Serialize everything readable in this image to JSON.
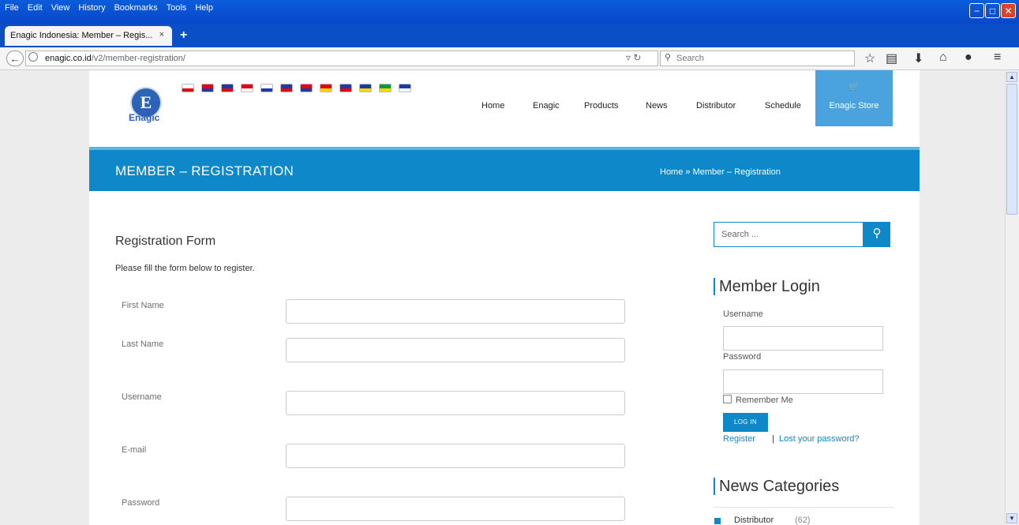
{
  "window": {
    "menu": [
      "File",
      "Edit",
      "View",
      "History",
      "Bookmarks",
      "Tools",
      "Help"
    ],
    "controls": {
      "minimize": "−",
      "restore": "□",
      "close": "✕"
    }
  },
  "browser": {
    "tab_title": "Enagic Indonesia: Member – Regis...",
    "tab_close": "×",
    "new_tab": "+",
    "url_domain": "enagic.co.id",
    "url_path": "/v2/member-registration/",
    "search_placeholder": "Search",
    "icons": [
      "back-icon",
      "globe-icon",
      "reload-icon",
      "search-icon",
      "star-icon",
      "reading-list-icon",
      "download-icon",
      "home-icon",
      "chat-icon",
      "menu-icon"
    ]
  },
  "site": {
    "logo_letter": "E",
    "logo_text": "Enagic",
    "flags": [
      {
        "name": "japan",
        "color": "#ffffff",
        "accent": "#e60012"
      },
      {
        "name": "taiwan",
        "color": "#e60012",
        "accent": "#1a3ca5"
      },
      {
        "name": "philippines",
        "color": "#1a3ca5",
        "accent": "#e60012"
      },
      {
        "name": "singapore",
        "color": "#e60012",
        "accent": "#ffffff"
      },
      {
        "name": "korea",
        "color": "#ffffff",
        "accent": "#1a3ca5"
      },
      {
        "name": "thailand",
        "color": "#1a3ca5",
        "accent": "#e60012"
      },
      {
        "name": "malaysia",
        "color": "#e60012",
        "accent": "#1a3ca5"
      },
      {
        "name": "vietnam",
        "color": "#e60012",
        "accent": "#ffd700"
      },
      {
        "name": "usa",
        "color": "#1a3ca5",
        "accent": "#e60012"
      },
      {
        "name": "eu",
        "color": "#1a3ca5",
        "accent": "#ffd700"
      },
      {
        "name": "brazil",
        "color": "#009b3a",
        "accent": "#ffd700"
      },
      {
        "name": "australia",
        "color": "#1a3ca5",
        "accent": "#ffffff"
      }
    ],
    "nav": [
      "Home",
      "Enagic",
      "Products",
      "News",
      "Distributor",
      "Schedule"
    ],
    "store_icon": "🛒",
    "store_label": "Enagic Store",
    "banner_title": "MEMBER – REGISTRATION",
    "breadcrumb": "Home » Member – Registration"
  },
  "form": {
    "title": "Registration Form",
    "subtitle": "Please fill the form below to register.",
    "fields": [
      {
        "label": "First Name",
        "value": ""
      },
      {
        "label": "Last Name",
        "value": ""
      },
      {
        "label": "Username",
        "value": ""
      },
      {
        "label": "E-mail",
        "value": ""
      },
      {
        "label": "Password",
        "value": ""
      }
    ]
  },
  "sidebar": {
    "search_placeholder": "Search ...",
    "login_title": "Member Login",
    "username_label": "Username",
    "password_label": "Password",
    "remember_label": "Remember Me",
    "login_button": "LOG IN",
    "register_link": "Register",
    "separator": "|",
    "lost_password_link": "Lost your password?",
    "news_title": "News Categories",
    "news_items": [
      {
        "label": "Distributor",
        "count": "(62)"
      }
    ]
  },
  "colors": {
    "accent": "#0e88c9",
    "titlebar": "#0a5ddb"
  }
}
